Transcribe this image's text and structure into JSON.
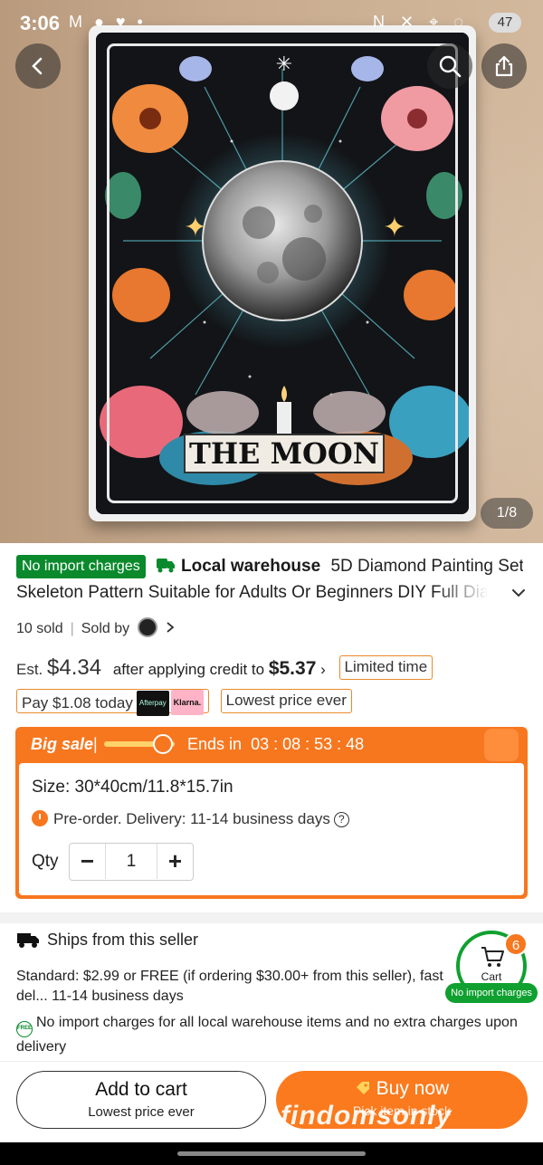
{
  "status": {
    "time": "3:06",
    "notifications": "M ● ♥ •",
    "system_icons": "N ✕ ⌖ ◌",
    "battery": "47"
  },
  "hero": {
    "card_title": "THE MOON",
    "image_counter": "1/8"
  },
  "product": {
    "no_import_tag": "No import charges",
    "local_warehouse": "Local warehouse",
    "title_line1": "5D Diamond Painting Set",
    "title_line2": "Skeleton Pattern Suitable for Adults Or Beginners DIY Full Diamo",
    "sold_count": "10 sold",
    "sold_by_label": "Sold by"
  },
  "pricing": {
    "est_label": "Est.",
    "est_price": "$4.34",
    "credit_text": "after applying credit to",
    "credit_price": "$5.37",
    "limited_time": "Limited time",
    "pay_today": "Pay $1.08 today",
    "afterpay": "Afterpay",
    "klarna": "Klarna.",
    "lowest_price": "Lowest price ever"
  },
  "sale": {
    "title": "Big sale",
    "ends_label": "Ends in",
    "countdown": "03 : 08 : 53 : 48",
    "size_text": "Size: 30*40cm/11.8*15.7in",
    "preorder_text": "Pre-order. Delivery: 11-14 business days",
    "qty_label": "Qty",
    "qty_value": "1",
    "minus": "−",
    "plus": "+"
  },
  "shipping": {
    "title": "Ships from this seller",
    "standard_text": "Standard: $2.99 or FREE (if ordering $30.00+ from this seller), fast del... 11-14 business days",
    "free_icon": "FREE",
    "noimport_text": "No import charges for all local warehouse items and no extra charges upon delivery"
  },
  "cart": {
    "label": "Cart",
    "badge": "6",
    "no_import": "No import charges"
  },
  "actions": {
    "add_to_cart": "Add to cart",
    "add_to_cart_sub": "Lowest price ever",
    "buy_now": "Buy now",
    "buy_now_sub": "Pick item in stock",
    "watermark": "findomsonly"
  },
  "colors": {
    "accent_orange": "#f7771f",
    "green": "#0a8a2c"
  }
}
